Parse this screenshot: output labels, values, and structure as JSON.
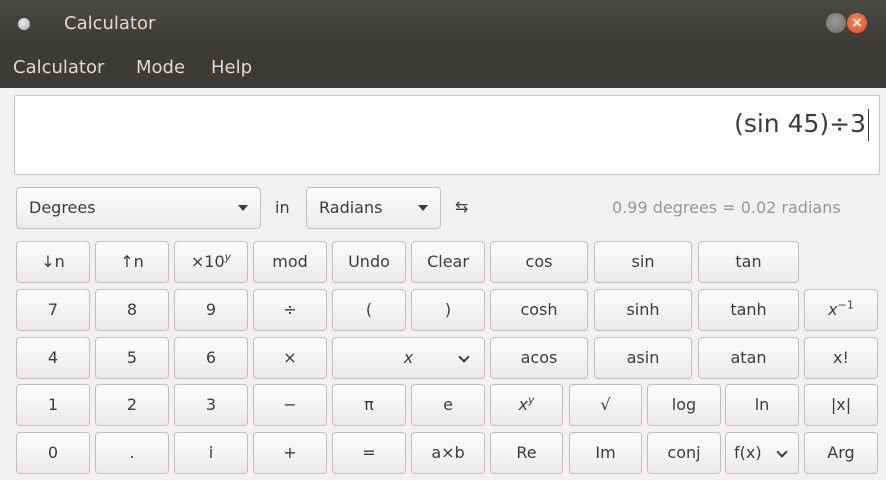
{
  "window": {
    "title": "Calculator"
  },
  "menu": [
    "Calculator",
    "Mode",
    "Help"
  ],
  "display": {
    "expression": "(sin 45)÷3"
  },
  "units": {
    "from": "Degrees",
    "in_label": "in",
    "to": "Radians",
    "conversion": "0.99 degrees = 0.02 radians"
  },
  "buttons": {
    "shift_down": "↓n",
    "shift_up": "↑n",
    "exp_base": "×10",
    "exp_sup": "y",
    "mod": "mod",
    "undo": "Undo",
    "clear": "Clear",
    "cos": "cos",
    "sin": "sin",
    "tan": "tan",
    "d7": "7",
    "d8": "8",
    "d9": "9",
    "divide": "÷",
    "lparen": "(",
    "rparen": ")",
    "cosh": "cosh",
    "sinh": "sinh",
    "tanh": "tanh",
    "inverse_base": "x",
    "inverse_sup": "−1",
    "d4": "4",
    "d5": "5",
    "d6": "6",
    "multiply": "×",
    "variable": "x",
    "acos": "acos",
    "asin": "asin",
    "atan": "atan",
    "factorial": "x!",
    "d1": "1",
    "d2": "2",
    "d3": "3",
    "subtract": "−",
    "pi": "π",
    "euler": "e",
    "power_base": "x",
    "power_sup": "y",
    "sqrt": "√",
    "log": "log",
    "ln": "ln",
    "abs": "|x|",
    "d0": "0",
    "point": ".",
    "imag": "i",
    "add": "+",
    "equals": "=",
    "ab": "a×b",
    "re": "Re",
    "im": "Im",
    "conj": "conj",
    "fx": "f(x)",
    "arg": "Arg"
  }
}
